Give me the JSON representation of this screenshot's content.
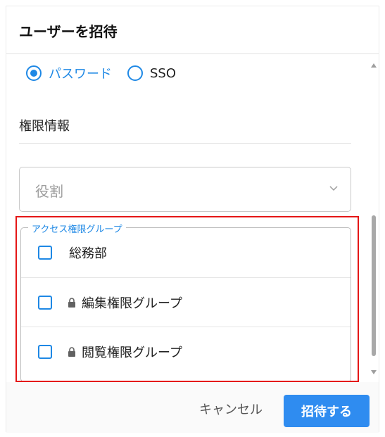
{
  "dialog": {
    "title": "ユーザーを招待"
  },
  "auth": {
    "options": [
      {
        "label": "パスワード",
        "selected": true
      },
      {
        "label": "SSO",
        "selected": false
      }
    ]
  },
  "permissions": {
    "section_title": "権限情報",
    "role_placeholder": "役割",
    "access_group": {
      "legend": "アクセス権限グループ",
      "items": [
        {
          "label": "総務部",
          "locked": false,
          "checked": false
        },
        {
          "label": "編集権限グループ",
          "locked": true,
          "checked": false
        },
        {
          "label": "閲覧権限グループ",
          "locked": true,
          "checked": false
        }
      ]
    }
  },
  "footer": {
    "cancel_label": "キャンセル",
    "submit_label": "招待する"
  },
  "colors": {
    "accent": "#1e88e5",
    "primary_button": "#2f8cf0",
    "highlight": "#e51616"
  }
}
